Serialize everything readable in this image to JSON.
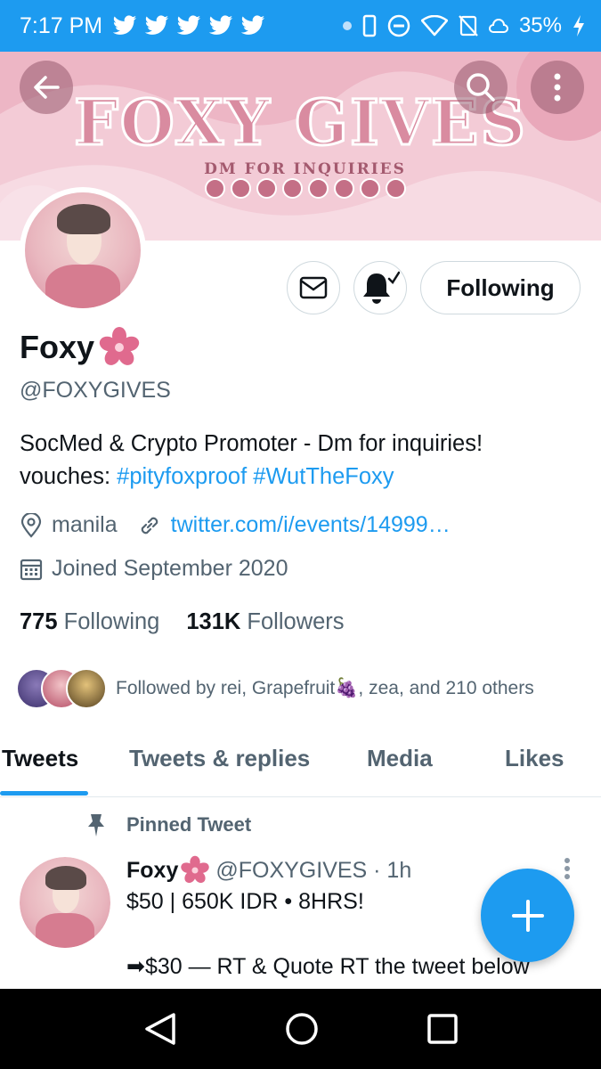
{
  "status_bar": {
    "time": "7:17 PM",
    "battery": "35%"
  },
  "banner": {
    "title": "FOXY GIVES",
    "subtitle": "DM FOR INQUIRIES"
  },
  "profile": {
    "name": "Foxy",
    "name_emoji": "🌸",
    "handle": "@FOXYGIVES",
    "bio_line1": "SocMed & Crypto Promoter - Dm for inquiries!",
    "bio_line2_prefix": "vouches: ",
    "bio_tags": [
      "#pityfoxproof",
      "#WutTheFoxy"
    ],
    "location": "manila",
    "website": "twitter.com/i/events/14999…",
    "joined": "Joined September 2020",
    "following_count": "775",
    "following_label": "Following",
    "followers_count": "131K",
    "followers_label": "Followers",
    "followed_by": "Followed by rei, Grapefruit🍇, zea, and 210 others"
  },
  "actions": {
    "following_button": "Following"
  },
  "tabs": [
    {
      "label": "Tweets",
      "active": true
    },
    {
      "label": "Tweets & replies",
      "active": false
    },
    {
      "label": "Media",
      "active": false
    },
    {
      "label": "Likes",
      "active": false
    }
  ],
  "pinned_tweet": {
    "pinned_label": "Pinned Tweet",
    "name": "Foxy",
    "name_emoji": "🌸",
    "handle": "@FOXYGIVES · 1h",
    "line1": "$50 | 650K IDR • 8HRS!",
    "line2": "➡$30 — RT & Quote RT the tweet below"
  },
  "colors": {
    "accent": "#1d9bf0",
    "text_primary": "#0f1419",
    "text_secondary": "#536471",
    "banner_bg": "#f3cbd6"
  }
}
